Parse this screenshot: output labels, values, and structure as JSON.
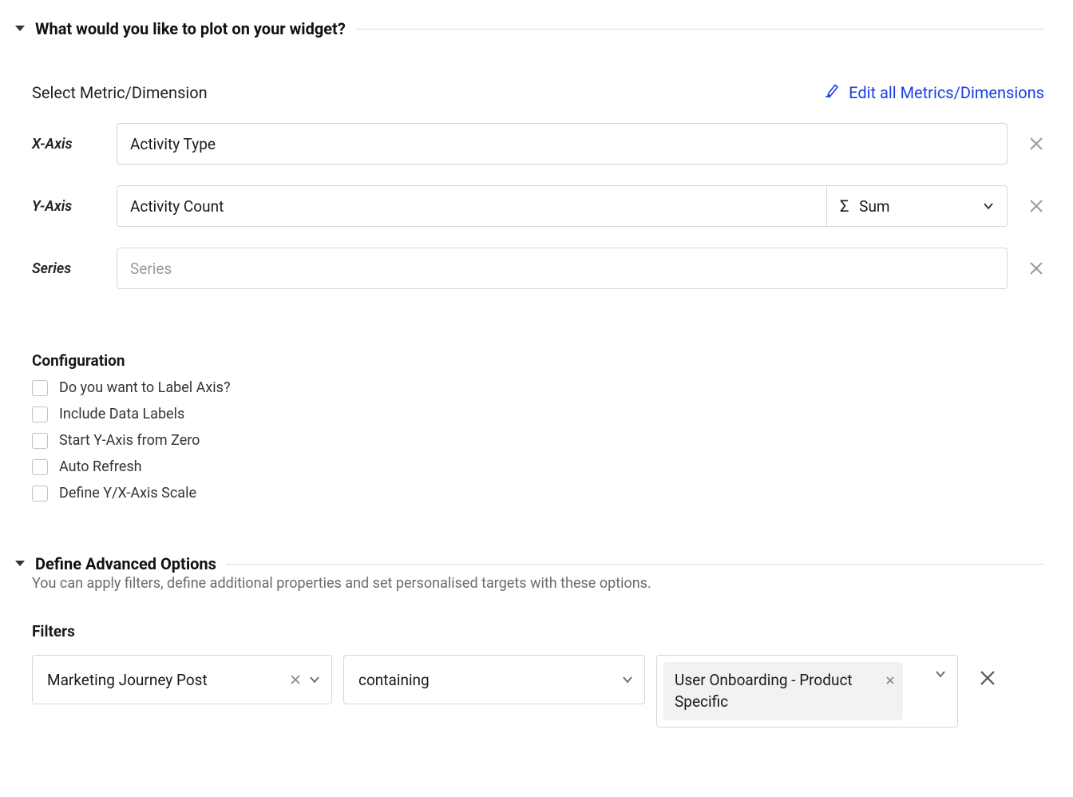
{
  "section1": {
    "title": "What would you like to plot on your widget?",
    "select_metric_label": "Select Metric/Dimension",
    "edit_all_link": "Edit all Metrics/Dimensions",
    "x_axis_label": "X-Axis",
    "x_axis_value": "Activity Type",
    "y_axis_label": "Y-Axis",
    "y_axis_value": "Activity Count",
    "y_axis_agg": "Sum",
    "series_label": "Series",
    "series_placeholder": "Series"
  },
  "config": {
    "title": "Configuration",
    "items": [
      "Do you want to Label Axis?",
      "Include Data Labels",
      "Start Y-Axis from Zero",
      "Auto Refresh",
      "Define Y/X-Axis Scale"
    ]
  },
  "section2": {
    "title": "Define Advanced Options",
    "subtitle": "You can apply filters, define additional properties and set personalised targets with these options."
  },
  "filters": {
    "title": "Filters",
    "field": "Marketing Journey Post",
    "operator": "containing",
    "value": "User Onboarding - Product Specific"
  }
}
